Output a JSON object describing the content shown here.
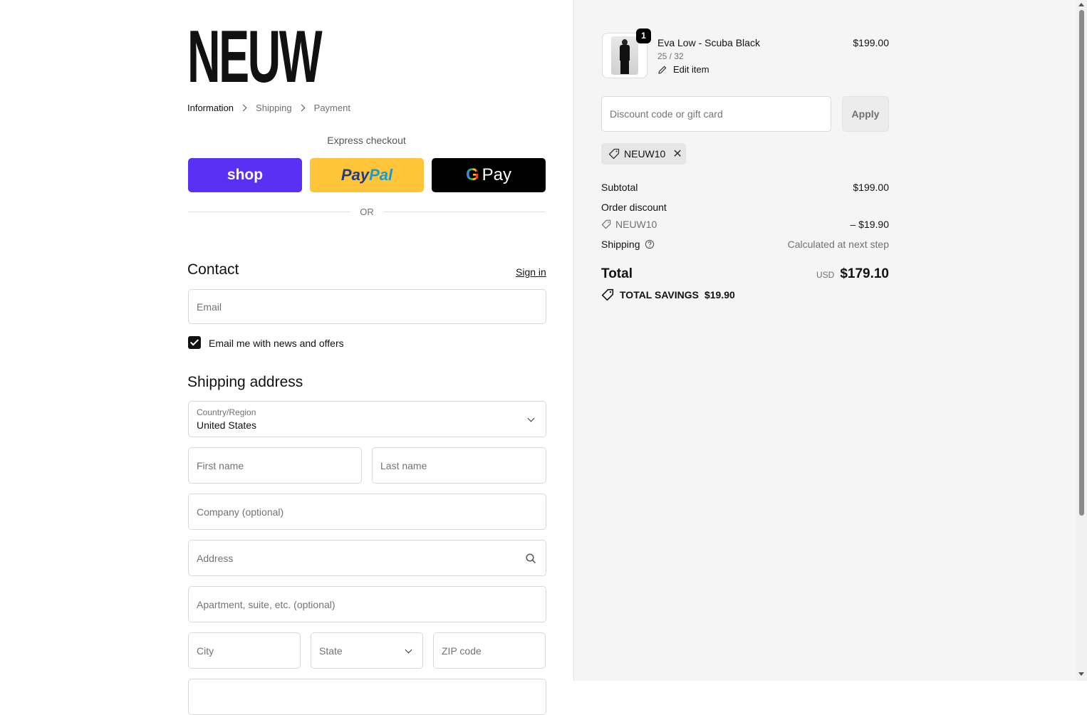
{
  "brand": {
    "logo_text": "NEUW"
  },
  "breadcrumb": {
    "items": [
      "Information",
      "Shipping",
      "Payment"
    ]
  },
  "express": {
    "label": "Express checkout",
    "shop_label": "shop",
    "paypal_part1": "Pay",
    "paypal_part2": "Pal",
    "gpay_g": "G",
    "gpay_label": "Pay",
    "or_label": "OR"
  },
  "contact": {
    "title": "Contact",
    "sign_in": "Sign in",
    "email_placeholder": "Email",
    "newsletter_label": "Email me with news and offers",
    "newsletter_checked": true
  },
  "shipping_address": {
    "title": "Shipping address",
    "country_label": "Country/Region",
    "country_value": "United States",
    "first_name_placeholder": "First name",
    "last_name_placeholder": "Last name",
    "company_placeholder": "Company (optional)",
    "address_placeholder": "Address",
    "apartment_placeholder": "Apartment, suite, etc. (optional)",
    "city_placeholder": "City",
    "state_placeholder": "State",
    "zip_placeholder": "ZIP code"
  },
  "cart": {
    "item": {
      "quantity": "1",
      "name": "Eva Low - Scuba Black",
      "variant": "25 / 32",
      "edit_label": "Edit item",
      "price": "$199.00"
    },
    "discount_placeholder": "Discount code or gift card",
    "apply_label": "Apply",
    "applied_code": "NEUW10"
  },
  "summary": {
    "subtotal_label": "Subtotal",
    "subtotal_value": "$199.00",
    "order_discount_label": "Order discount",
    "discount_code": "NEUW10",
    "discount_value": "– $19.90",
    "shipping_label": "Shipping",
    "shipping_value": "Calculated at next step",
    "total_label": "Total",
    "currency": "USD",
    "total_value": "$179.10",
    "savings_label": "TOTAL SAVINGS",
    "savings_value": "$19.90"
  },
  "colors": {
    "shop_purple": "#5a31f4",
    "paypal_yellow": "#ffc439",
    "gpay_black": "#000000",
    "panel_gray": "#f5f5f5"
  }
}
